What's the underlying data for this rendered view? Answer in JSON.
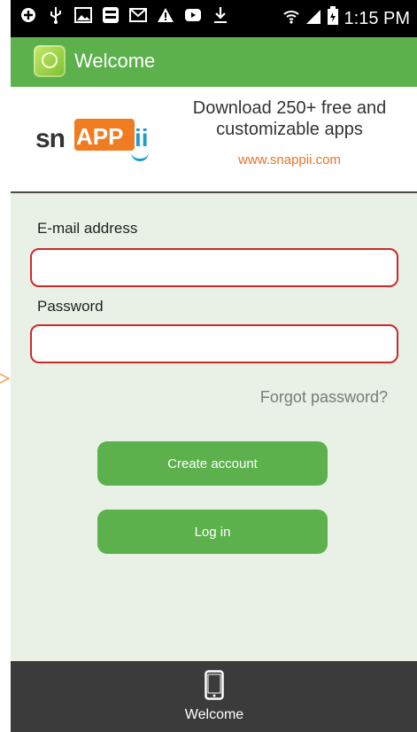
{
  "status_bar": {
    "time": "1:15 PM",
    "left_icons": [
      "add-icon",
      "usb-icon",
      "image-icon",
      "app-icon",
      "gmail-icon",
      "warning-icon",
      "youtube-icon",
      "download-icon"
    ],
    "right_icons": [
      "wifi-icon",
      "signal-icon",
      "battery-icon"
    ]
  },
  "action_bar": {
    "title": "Welcome"
  },
  "banner": {
    "logo_sn": "sn",
    "logo_app": "APP",
    "logo_ii": "ii",
    "headline": "Download 250+ free and customizable apps",
    "url": "www.snappii.com"
  },
  "form": {
    "email_label": "E-mail address",
    "email_value": "",
    "password_label": "Password",
    "password_value": "",
    "forgot_link": "Forgot password?"
  },
  "buttons": {
    "create_account": "Create account",
    "log_in": "Log in"
  },
  "tab_bar": {
    "items": [
      {
        "label": "Welcome",
        "icon": "phone-icon"
      }
    ]
  },
  "colors": {
    "accent": "#5cb14d",
    "background": "#e9f1e6",
    "field_border": "#cc2a2a",
    "tab_bar": "#3b3b3b",
    "link": "#e8742a"
  }
}
